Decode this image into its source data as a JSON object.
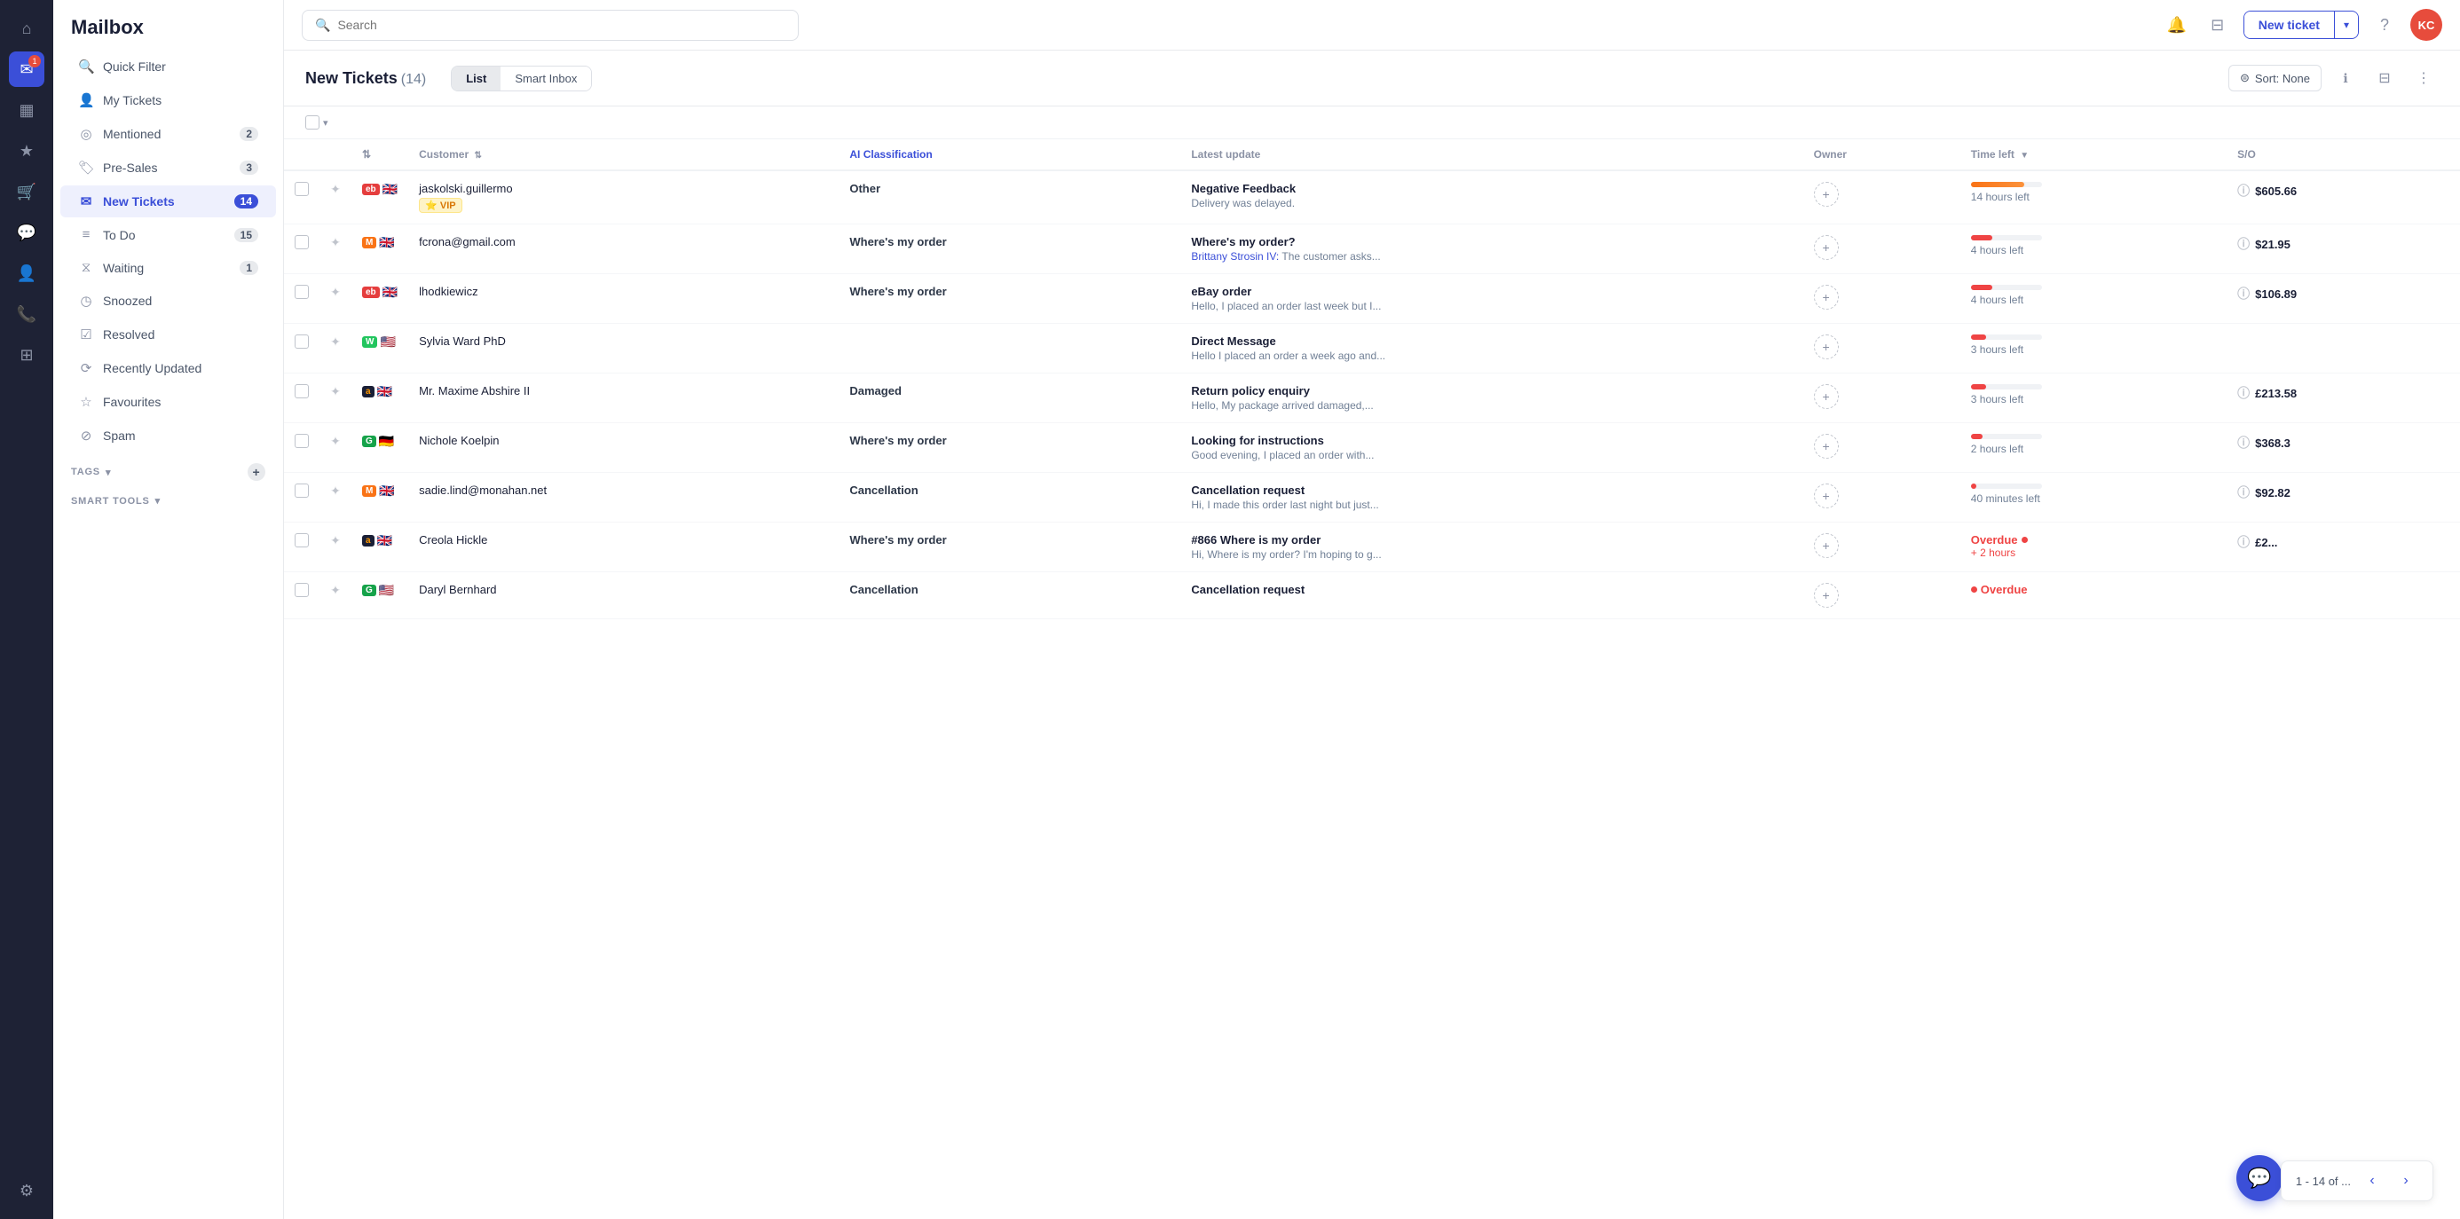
{
  "app": {
    "title": "Mailbox"
  },
  "iconBar": {
    "home_icon": "⌂",
    "mailbox_icon": "✉",
    "chart_icon": "▦",
    "star_icon": "★",
    "cart_icon": "🛒",
    "chat_icon": "💬",
    "contacts_icon": "👤",
    "phone_icon": "📞",
    "groups_icon": "⊞",
    "settings_icon": "⚙",
    "avatar_label": "KC",
    "badge": "1"
  },
  "sidebar": {
    "header": "Mailbox",
    "items": [
      {
        "id": "quick-filter",
        "icon": "🔍",
        "label": "Quick Filter",
        "count": null,
        "active": false
      },
      {
        "id": "my-tickets",
        "icon": "👤",
        "label": "My Tickets",
        "count": null,
        "active": false
      },
      {
        "id": "mentioned",
        "icon": "◎",
        "label": "Mentioned",
        "count": "2",
        "active": false
      },
      {
        "id": "pre-sales",
        "icon": "🏷",
        "label": "Pre-Sales",
        "count": "3",
        "active": false
      },
      {
        "id": "new-tickets",
        "icon": "✉",
        "label": "New Tickets",
        "count": "14",
        "active": true
      },
      {
        "id": "to-do",
        "icon": "≡",
        "label": "To Do",
        "count": "15",
        "active": false
      },
      {
        "id": "waiting",
        "icon": "⧖",
        "label": "Waiting",
        "count": "1",
        "active": false
      },
      {
        "id": "snoozed",
        "icon": "◷",
        "label": "Snoozed",
        "count": null,
        "active": false
      },
      {
        "id": "resolved",
        "icon": "☑",
        "label": "Resolved",
        "count": null,
        "active": false
      },
      {
        "id": "recently-updated",
        "icon": "⟳",
        "label": "Recently Updated",
        "count": null,
        "active": false
      },
      {
        "id": "favourites",
        "icon": "☆",
        "label": "Favourites",
        "count": null,
        "active": false
      },
      {
        "id": "spam",
        "icon": "⊘",
        "label": "Spam",
        "count": null,
        "active": false
      }
    ],
    "tags_label": "TAGS",
    "smart_tools_label": "SMART TOOLS"
  },
  "topbar": {
    "search_placeholder": "Search",
    "new_ticket_label": "New ticket",
    "notification_icon": "🔔",
    "filter_icon": "⊟",
    "help_icon": "?"
  },
  "content": {
    "title": "New Tickets",
    "count": "(14)",
    "list_label": "List",
    "smart_inbox_label": "Smart Inbox",
    "sort_label": "Sort: None",
    "columns": [
      {
        "id": "star",
        "label": ""
      },
      {
        "id": "source",
        "label": ""
      },
      {
        "id": "customer",
        "label": "Customer"
      },
      {
        "id": "ai",
        "label": "AI Classification"
      },
      {
        "id": "update",
        "label": "Latest update"
      },
      {
        "id": "owner",
        "label": "Owner"
      },
      {
        "id": "time",
        "label": "Time left"
      },
      {
        "id": "so",
        "label": "S/O"
      }
    ],
    "rows": [
      {
        "id": 1,
        "source_icon": "eb",
        "flag": "🇬🇧",
        "customer": "jaskolski.guillermo",
        "vip": true,
        "classification": "Other",
        "update_title": "Negative Feedback",
        "update_sub": "Delivery was delayed.",
        "update_author": "",
        "time_pct": 75,
        "time_color": "orange",
        "time_text": "14 hours left",
        "overdue": false,
        "so_value": "$605.66"
      },
      {
        "id": 2,
        "source_icon": "mg",
        "flag": "🇬🇧",
        "customer": "fcrona@gmail.com",
        "vip": false,
        "classification": "Where's my order",
        "update_title": "Where's my order?",
        "update_sub": "Brittany Strosin IV: The customer asks...",
        "update_author": "Brittany Strosin IV",
        "time_pct": 30,
        "time_color": "red",
        "time_text": "4 hours left",
        "overdue": false,
        "so_value": "$21.95"
      },
      {
        "id": 3,
        "source_icon": "eb",
        "flag": "🇬🇧",
        "customer": "lhodkiewicz",
        "vip": false,
        "classification": "Where's my order",
        "update_title": "eBay order",
        "update_sub": "Hello, I placed an order last week but I...",
        "update_author": "",
        "time_pct": 30,
        "time_color": "red",
        "time_text": "4 hours left",
        "overdue": false,
        "so_value": "$106.89"
      },
      {
        "id": 4,
        "source_icon": "wp",
        "flag": "🇺🇸",
        "customer": "Sylvia Ward PhD",
        "vip": false,
        "classification": "",
        "update_title": "Direct Message",
        "update_sub": "Hello I placed an order a week ago and...",
        "update_author": "",
        "time_pct": 22,
        "time_color": "red",
        "time_text": "3 hours left",
        "overdue": false,
        "so_value": ""
      },
      {
        "id": 5,
        "source_icon": "az",
        "flag": "🇬🇧",
        "customer": "Mr. Maxime Abshire II",
        "vip": false,
        "classification": "Damaged",
        "update_title": "Return policy enquiry",
        "update_sub": "Hello, My package arrived damaged,...",
        "update_author": "",
        "time_pct": 22,
        "time_color": "red",
        "time_text": "3 hours left",
        "overdue": false,
        "so_value": "£213.58"
      },
      {
        "id": 6,
        "source_icon": "gs",
        "flag": "🇩🇪",
        "customer": "Nichole Koelpin",
        "vip": false,
        "classification": "Where's my order",
        "update_title": "Looking for instructions",
        "update_sub": "Good evening, I placed an order with...",
        "update_author": "",
        "time_pct": 16,
        "time_color": "red",
        "time_text": "2 hours left",
        "overdue": false,
        "so_value": "$368.3"
      },
      {
        "id": 7,
        "source_icon": "mg",
        "flag": "🇬🇧",
        "customer": "sadie.lind@monahan.net",
        "vip": false,
        "classification": "Cancellation",
        "update_title": "Cancellation request",
        "update_sub": "Hi, I made this order last night but just...",
        "update_author": "",
        "time_pct": 8,
        "time_color": "red",
        "time_text": "40 minutes left",
        "overdue": false,
        "so_value": "$92.82"
      },
      {
        "id": 8,
        "source_icon": "az",
        "flag": "🇬🇧",
        "customer": "Creola Hickle",
        "vip": false,
        "classification": "Where's my order",
        "update_title": "#866 Where is my order",
        "update_sub": "Hi, Where is my order? I'm hoping to g...",
        "update_author": "",
        "time_pct": 0,
        "time_color": "red",
        "time_text": "+ 2 hours",
        "overdue": true,
        "so_value": "£2..."
      },
      {
        "id": 9,
        "source_icon": "gs",
        "flag": "🇺🇸",
        "customer": "Daryl Bernhard",
        "vip": false,
        "classification": "Cancellation",
        "update_title": "Cancellation request",
        "update_sub": "",
        "update_author": "",
        "time_pct": 0,
        "time_color": "red",
        "time_text": "Overdue",
        "overdue": true,
        "so_value": ""
      }
    ],
    "pagination": "1 - 14 of ..."
  }
}
